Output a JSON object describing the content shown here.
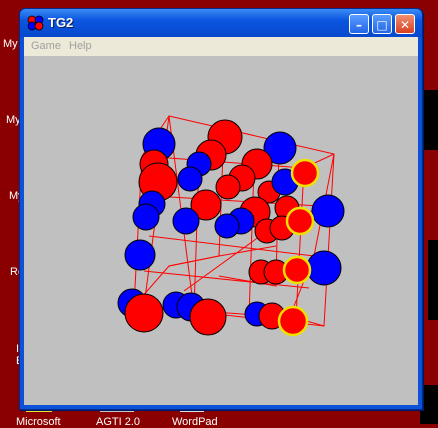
{
  "window": {
    "title": "TG2"
  },
  "menu": {
    "items": [
      "Game",
      "Help"
    ]
  },
  "title_buttons": {
    "minimize": "–",
    "maximize": "□",
    "close": "✕"
  },
  "desktop": {
    "labels": [
      "My",
      "My",
      "My",
      "Re",
      "I",
      "E"
    ],
    "taskbar_labels": [
      "Microsoft",
      "AGTI 2.0",
      "WordPad"
    ]
  },
  "colors": {
    "red": "#ff0000",
    "blue": "#0000ff",
    "highlight_ring": "#ffee00",
    "grid_lines": "#ff0000",
    "canvas": "#c0c0c0"
  },
  "board": {
    "description_spheres": [
      {
        "color": "red"
      },
      {
        "color": "red"
      },
      {
        "color": "red"
      },
      {
        "color": "blue"
      },
      {
        "color": "blue"
      }
    ]
  }
}
